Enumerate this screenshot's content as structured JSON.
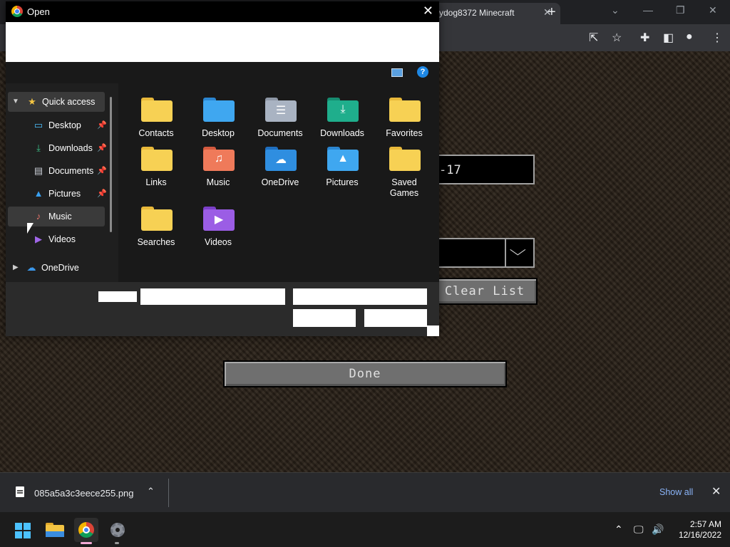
{
  "browser": {
    "tab_title": "ydog8372 Minecraft",
    "tab_close": "✕",
    "newtab": "+",
    "window_controls": {
      "menu": "⌄",
      "minimize": "—",
      "restore": "❐",
      "close": "✕"
    },
    "toolbar_icons": [
      "share-icon",
      "star-icon",
      "extensions-icon",
      "sidepanel-icon",
      "profile-icon",
      "menu-icon"
    ],
    "toolbar_glyphs": {
      "share": "⇱",
      "star": "☆",
      "extensions": "✚",
      "sidepanel": "◧",
      "profile": "●",
      "menu": "⋮"
    }
  },
  "page": {
    "field_text": "-17",
    "select_arrow": "⌵",
    "clear_button": "Clear List",
    "done_button": "Done"
  },
  "dialog": {
    "title": "Open",
    "close": "✕",
    "help": "?",
    "nav": {
      "quick_access": "Quick access",
      "items": [
        {
          "label": "Desktop",
          "icon": "desktop-icon",
          "glyph": "▭",
          "color": "#4cc2ff",
          "pinned": true
        },
        {
          "label": "Downloads",
          "icon": "downloads-icon",
          "glyph": "⤓",
          "color": "#3cc38a",
          "pinned": true
        },
        {
          "label": "Documents",
          "icon": "documents-icon",
          "glyph": "▤",
          "color": "#c8ccd4",
          "pinned": true
        },
        {
          "label": "Pictures",
          "icon": "pictures-icon",
          "glyph": "▲",
          "color": "#39a0f0",
          "pinned": true
        },
        {
          "label": "Music",
          "icon": "music-icon",
          "glyph": "♪",
          "color": "#e8746a",
          "pinned": false
        },
        {
          "label": "Videos",
          "icon": "videos-icon",
          "glyph": "▶",
          "color": "#a066e8",
          "pinned": false
        }
      ],
      "onedrive": "OneDrive",
      "pin_glyph": "📌"
    },
    "folders": [
      {
        "label": "Contacts",
        "body": "#f7d154",
        "tab": "#e9b93a",
        "glyph": ""
      },
      {
        "label": "Desktop",
        "body": "#3fa7f0",
        "tab": "#2b86d1",
        "glyph": ""
      },
      {
        "label": "Documents",
        "body": "#a9b3c2",
        "tab": "#8e97a6",
        "glyph": "☰"
      },
      {
        "label": "Downloads",
        "body": "#1fae8c",
        "tab": "#168c70",
        "glyph": "⤓"
      },
      {
        "label": "Favorites",
        "body": "#f7d154",
        "tab": "#e9b93a",
        "glyph": ""
      },
      {
        "label": "Links",
        "body": "#f7d154",
        "tab": "#e9b93a",
        "glyph": ""
      },
      {
        "label": "Music",
        "body": "#ef7a5a",
        "tab": "#d45a3e",
        "glyph": "♫"
      },
      {
        "label": "OneDrive",
        "body": "#2f8ee0",
        "tab": "#1f6fc0",
        "glyph": "☁"
      },
      {
        "label": "Pictures",
        "body": "#3fa7f0",
        "tab": "#2b86d1",
        "glyph": "▲"
      },
      {
        "label": "Saved Games",
        "body": "#f7d154",
        "tab": "#e9b93a",
        "glyph": ""
      },
      {
        "label": "Searches",
        "body": "#f7d154",
        "tab": "#e9b93a",
        "glyph": ""
      },
      {
        "label": "Videos",
        "body": "#9b5de5",
        "tab": "#7b3fc8",
        "glyph": "▶"
      }
    ]
  },
  "download_bar": {
    "filename": "085a5a3c3eece255.png",
    "chevron": "⌃",
    "show_all": "Show all",
    "close": "✕"
  },
  "taskbar": {
    "tray": {
      "chevron": "⌃",
      "network": "🖵",
      "volume": "🔊"
    },
    "time": "2:57 AM",
    "date": "12/16/2022"
  }
}
